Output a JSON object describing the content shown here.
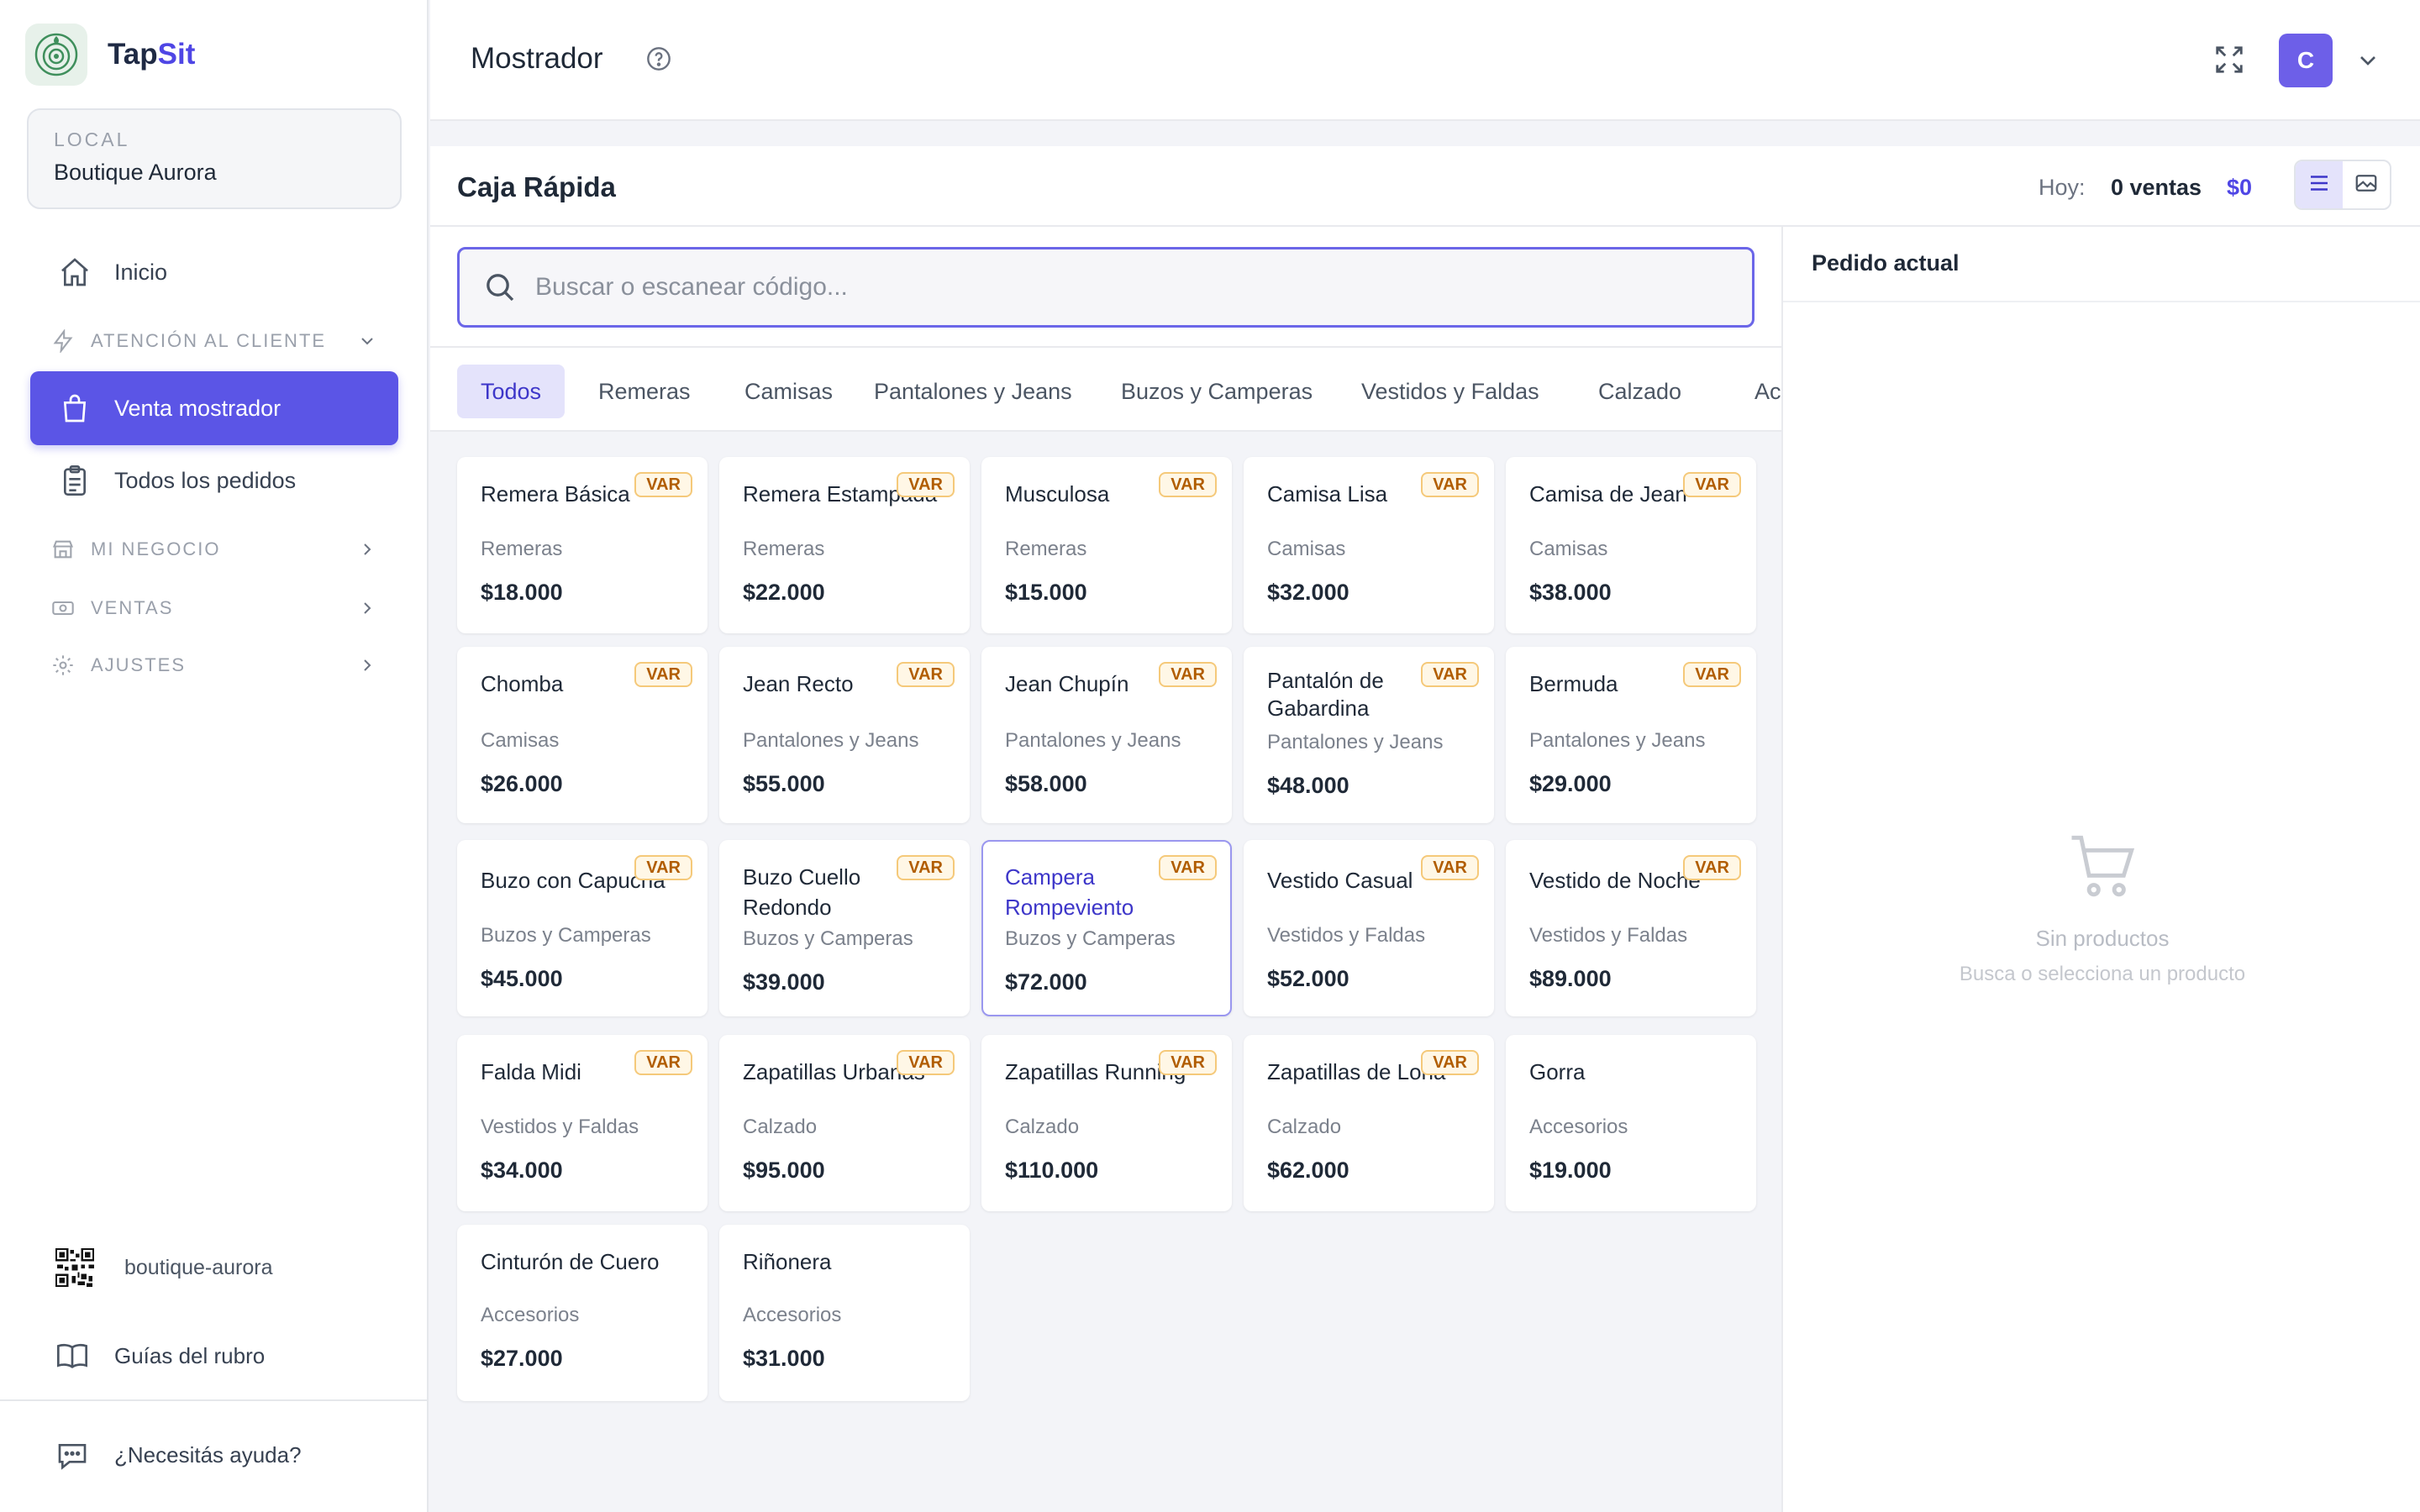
{
  "brand": {
    "name_part1": "Tap",
    "name_part2": "Sit"
  },
  "local": {
    "label": "LOCAL",
    "name": "Boutique Aurora"
  },
  "nav": {
    "inicio": "Inicio",
    "atencion": "ATENCIÓN AL CLIENTE",
    "venta": "Venta mostrador",
    "pedidos": "Todos los pedidos",
    "negocio": "MI NEGOCIO",
    "ventas": "VENTAS",
    "ajustes": "AJUSTES"
  },
  "sidebar_bottom": {
    "qr_slug": "boutique-aurora",
    "guias": "Guías del rubro",
    "ayuda": "¿Necesitás ayuda?"
  },
  "header": {
    "title": "Mostrador",
    "avatar_initial": "C"
  },
  "caja": {
    "title": "Caja Rápida",
    "hoy_label": "Hoy:",
    "hoy_ventas": "0 ventas",
    "hoy_total": "$0"
  },
  "search": {
    "placeholder": "Buscar o escanear código..."
  },
  "tabs": [
    "Todos",
    "Remeras",
    "Camisas",
    "Pantalones y Jeans",
    "Buzos y Camperas",
    "Vestidos y Faldas",
    "Calzado",
    "Accesorios"
  ],
  "badge_label": "VAR",
  "products": [
    {
      "name": "Remera Básica",
      "category": "Remeras",
      "price": "$18.000",
      "var": true
    },
    {
      "name": "Remera Estampada",
      "category": "Remeras",
      "price": "$22.000",
      "var": true
    },
    {
      "name": "Musculosa",
      "category": "Remeras",
      "price": "$15.000",
      "var": true
    },
    {
      "name": "Camisa Lisa",
      "category": "Camisas",
      "price": "$32.000",
      "var": true
    },
    {
      "name": "Camisa de Jean",
      "category": "Camisas",
      "price": "$38.000",
      "var": true
    },
    {
      "name": "Chomba",
      "category": "Camisas",
      "price": "$26.000",
      "var": true
    },
    {
      "name": "Jean Recto",
      "category": "Pantalones y Jeans",
      "price": "$55.000",
      "var": true
    },
    {
      "name": "Jean Chupín",
      "category": "Pantalones y Jeans",
      "price": "$58.000",
      "var": true
    },
    {
      "name": "Pantalón de Gabardina",
      "category": "Pantalones y Jeans",
      "price": "$48.000",
      "var": true
    },
    {
      "name": "Bermuda",
      "category": "Pantalones y Jeans",
      "price": "$29.000",
      "var": true
    },
    {
      "name": "Buzo con Capucha",
      "category": "Buzos y Camperas",
      "price": "$45.000",
      "var": true
    },
    {
      "name": "Buzo Cuello Redondo",
      "category": "Buzos y Camperas",
      "price": "$39.000",
      "var": true
    },
    {
      "name": "Campera Rompeviento",
      "category": "Buzos y Camperas",
      "price": "$72.000",
      "var": true
    },
    {
      "name": "Vestido Casual",
      "category": "Vestidos y Faldas",
      "price": "$52.000",
      "var": true
    },
    {
      "name": "Vestido de Noche",
      "category": "Vestidos y Faldas",
      "price": "$89.000",
      "var": true
    },
    {
      "name": "Falda Midi",
      "category": "Vestidos y Faldas",
      "price": "$34.000",
      "var": true
    },
    {
      "name": "Zapatillas Urbanas",
      "category": "Calzado",
      "price": "$95.000",
      "var": true
    },
    {
      "name": "Zapatillas Running",
      "category": "Calzado",
      "price": "$110.000",
      "var": true
    },
    {
      "name": "Zapatillas de Lona",
      "category": "Calzado",
      "price": "$62.000",
      "var": true
    },
    {
      "name": "Gorra",
      "category": "Accesorios",
      "price": "$19.000",
      "var": false
    },
    {
      "name": "Cinturón de Cuero",
      "category": "Accesorios",
      "price": "$27.000",
      "var": false
    },
    {
      "name": "Riñonera",
      "category": "Accesorios",
      "price": "$31.000",
      "var": false
    }
  ],
  "order": {
    "title": "Pedido actual",
    "empty_title": "Sin productos",
    "empty_sub": "Busca o selecciona un producto"
  },
  "colors": {
    "accent": "#5b55e6",
    "badge_text": "#b15d00",
    "badge_bg": "#fff7e6"
  }
}
